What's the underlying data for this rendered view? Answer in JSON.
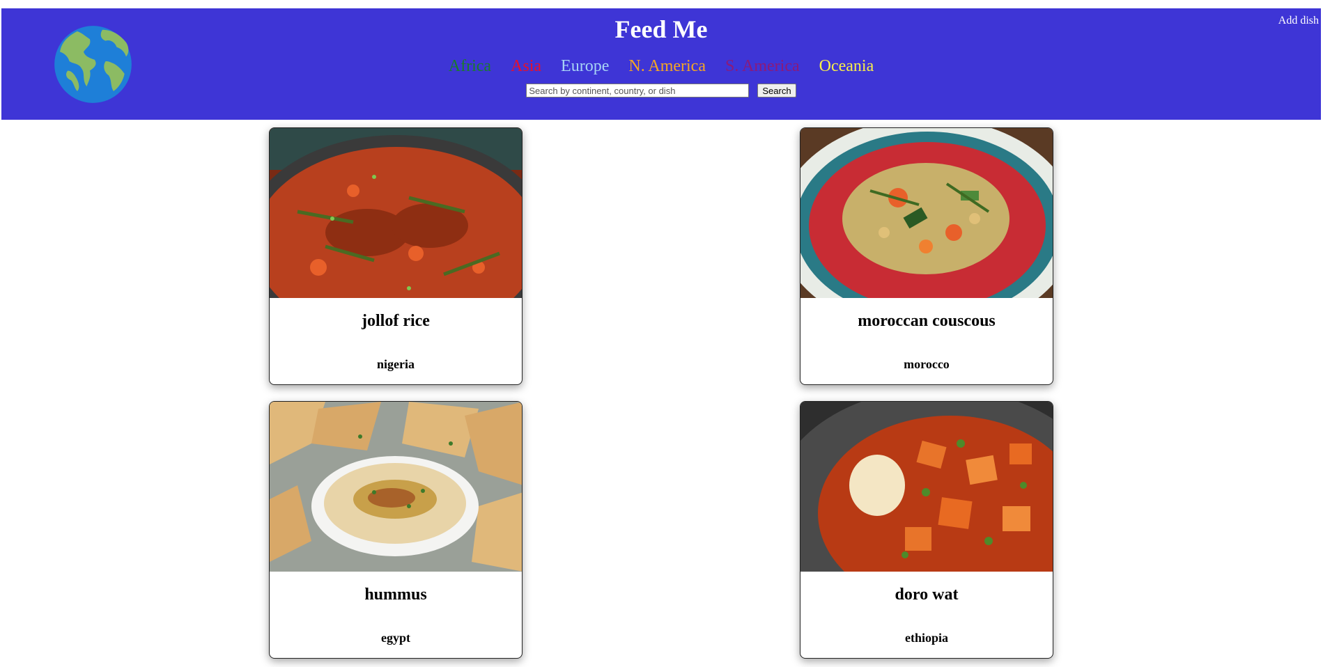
{
  "header": {
    "title": "Feed Me",
    "add_dish_label": "Add dish",
    "logo_icon": "globe-icon",
    "background_color": "#3e35d6"
  },
  "nav": {
    "items": [
      {
        "label": "Africa",
        "color": "#1a7a2e"
      },
      {
        "label": "Asia",
        "color": "#e8102a"
      },
      {
        "label": "Europe",
        "color": "#a8d4f5"
      },
      {
        "label": "N. America",
        "color": "#f5a623"
      },
      {
        "label": "S. America",
        "color": "#8b1a7a"
      },
      {
        "label": "Oceania",
        "color": "#f8ee4a"
      }
    ]
  },
  "search": {
    "placeholder": "Search by continent, country, or dish",
    "value": "",
    "button_label": "Search"
  },
  "dishes": [
    {
      "name": "jollof rice",
      "country": "nigeria",
      "image_icon": "jollof-rice-photo"
    },
    {
      "name": "moroccan couscous",
      "country": "morocco",
      "image_icon": "moroccan-couscous-photo"
    },
    {
      "name": "hummus",
      "country": "egypt",
      "image_icon": "hummus-photo"
    },
    {
      "name": "doro wat",
      "country": "ethiopia",
      "image_icon": "doro-wat-photo"
    }
  ]
}
